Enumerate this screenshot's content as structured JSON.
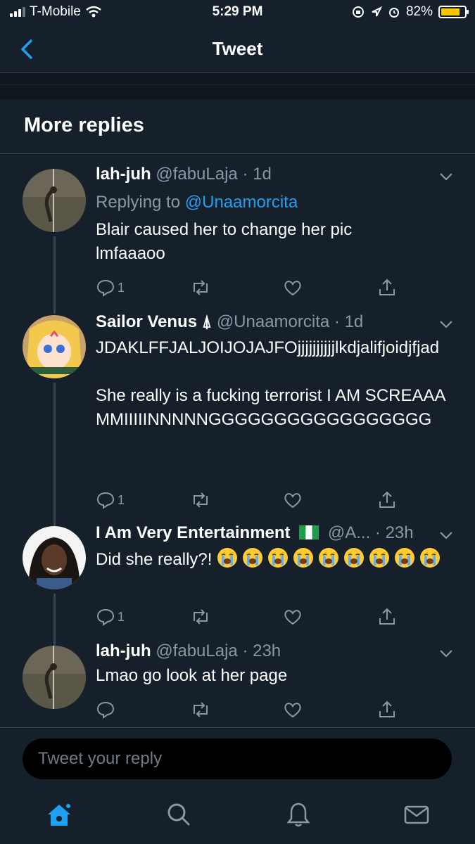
{
  "status": {
    "carrier": "T-Mobile",
    "time": "5:29 PM",
    "battery": "82%",
    "battery_level": 0.82
  },
  "nav": {
    "title": "Tweet"
  },
  "section": {
    "title": "More replies"
  },
  "tweets": [
    {
      "name": "lah-juh",
      "handle": "@fabuLaja",
      "time": "1d",
      "replying_prefix": "Replying to",
      "replying_to": "@Unaamorcita",
      "text": "Blair caused her to change her pic\nlmfaaaoo",
      "reply_count": "1"
    },
    {
      "name": "Sailor Venus",
      "name_badge": "⍋",
      "handle": "@Unaamorcita",
      "time": "1d",
      "text": "JDAKLFFJALJOIJOJAJFOjjjjjjjjjjlkdjalifjoidjfjad\n\nShe really is a fucking terrorist I AM SCREAAAMMIIIIINNNNNGGGGGGGGGGGGGGGGG",
      "reply_count": "1"
    },
    {
      "name": "I Am Very Entertainment",
      "handle": "@A...",
      "time": "23h",
      "text": "Did she really?!",
      "emoji": "😭",
      "emoji_count": 9,
      "reply_count": "1"
    },
    {
      "name": "lah-juh",
      "handle": "@fabuLaja",
      "time": "23h",
      "text": "Lmao go look at her page",
      "reply_count": ""
    }
  ],
  "composer": {
    "placeholder": "Tweet your reply"
  },
  "colors": {
    "background": "#15202b",
    "accent": "#1da1f2",
    "muted": "#8899a6",
    "divider": "#38444d"
  },
  "icons": [
    "chevron-left-icon",
    "caret-down-icon",
    "reply-icon",
    "retweet-icon",
    "like-icon",
    "share-icon",
    "home-icon",
    "search-icon",
    "notifications-icon",
    "messages-icon"
  ]
}
